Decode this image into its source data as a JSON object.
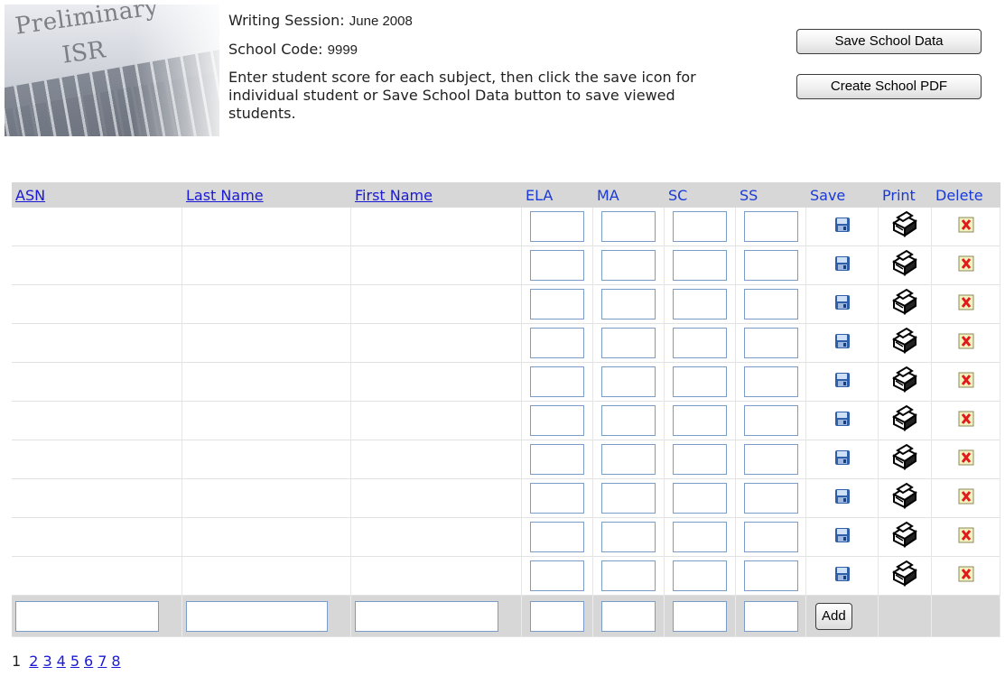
{
  "logo": {
    "line1": "Preliminary",
    "line2": "ISR"
  },
  "info": {
    "session_label": "Writing Session:",
    "session_value": "June 2008",
    "code_label": "School Code:",
    "code_value": "9999",
    "instructions": "Enter student score for each subject, then click the save icon for individual student or Save School Data button to save viewed students."
  },
  "buttons": {
    "save_school": "Save School Data",
    "create_pdf": "Create School PDF",
    "add": "Add"
  },
  "columns": [
    "ASN",
    "Last Name",
    "First Name",
    "ELA",
    "MA",
    "SC",
    "SS",
    "Save",
    "Print",
    "Delete"
  ],
  "sortable_columns": [
    "ASN",
    "Last Name",
    "First Name"
  ],
  "row_count": 10,
  "rows": [
    {
      "asn": "",
      "last_name": "",
      "first_name": "",
      "ela": "",
      "ma": "",
      "sc": "",
      "ss": ""
    },
    {
      "asn": "",
      "last_name": "",
      "first_name": "",
      "ela": "",
      "ma": "",
      "sc": "",
      "ss": ""
    },
    {
      "asn": "",
      "last_name": "",
      "first_name": "",
      "ela": "",
      "ma": "",
      "sc": "",
      "ss": ""
    },
    {
      "asn": "",
      "last_name": "",
      "first_name": "",
      "ela": "",
      "ma": "",
      "sc": "",
      "ss": ""
    },
    {
      "asn": "",
      "last_name": "",
      "first_name": "",
      "ela": "",
      "ma": "",
      "sc": "",
      "ss": ""
    },
    {
      "asn": "",
      "last_name": "",
      "first_name": "",
      "ela": "",
      "ma": "",
      "sc": "",
      "ss": ""
    },
    {
      "asn": "",
      "last_name": "",
      "first_name": "",
      "ela": "",
      "ma": "",
      "sc": "",
      "ss": ""
    },
    {
      "asn": "",
      "last_name": "",
      "first_name": "",
      "ela": "",
      "ma": "",
      "sc": "",
      "ss": ""
    },
    {
      "asn": "",
      "last_name": "",
      "first_name": "",
      "ela": "",
      "ma": "",
      "sc": "",
      "ss": ""
    },
    {
      "asn": "",
      "last_name": "",
      "first_name": "",
      "ela": "",
      "ma": "",
      "sc": "",
      "ss": ""
    }
  ],
  "icons": {
    "save": "floppy-disk-icon",
    "print": "printer-icon",
    "delete": "delete-icon"
  },
  "pagination": {
    "current": "1",
    "pages": [
      "2",
      "3",
      "4",
      "5",
      "6",
      "7",
      "8"
    ]
  },
  "colors": {
    "link": "#1a1ad6",
    "header_bg": "#d7d7d7",
    "input_border": "#7a9cc8",
    "delete_red": "#e01b1b"
  }
}
